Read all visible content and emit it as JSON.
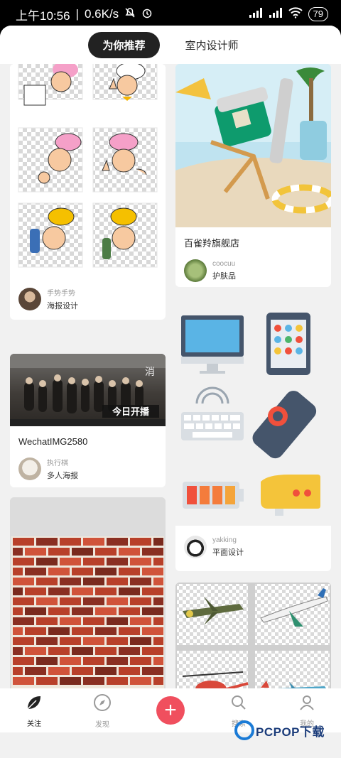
{
  "status_bar": {
    "time": "上午10:56",
    "speed": "0.6K/s",
    "battery": "79"
  },
  "tabs": [
    {
      "label": "为你推荐",
      "active": true
    },
    {
      "label": "室内设计师",
      "active": false
    }
  ],
  "feed": {
    "left": [
      {
        "id": "chef",
        "title": "",
        "author": "手势手势",
        "category": "海报设计"
      },
      {
        "id": "poster",
        "title": "WechatIMG2580",
        "author": "执行棋",
        "category": "多人海报",
        "poster_text": "今日开播"
      },
      {
        "id": "brick",
        "title": "",
        "author": "",
        "category": ""
      }
    ],
    "right": [
      {
        "id": "beach",
        "title": "百雀羚旗舰店",
        "author": "coocuu",
        "category": "护肤品"
      },
      {
        "id": "devices",
        "title": "",
        "author": "yakking",
        "category": "平面设计"
      },
      {
        "id": "planes",
        "title": "",
        "author": "",
        "category": ""
      }
    ]
  },
  "bottom_nav": [
    {
      "label": "关注",
      "icon": "leaf-icon",
      "active": true
    },
    {
      "label": "发现",
      "icon": "compass-icon",
      "active": false
    },
    {
      "label": "",
      "icon": "plus-icon",
      "active": false
    },
    {
      "label": "搜索",
      "icon": "search-icon",
      "active": false
    },
    {
      "label": "我的",
      "icon": "person-icon",
      "active": false
    }
  ],
  "watermark": {
    "text": "PCPOP下载"
  }
}
